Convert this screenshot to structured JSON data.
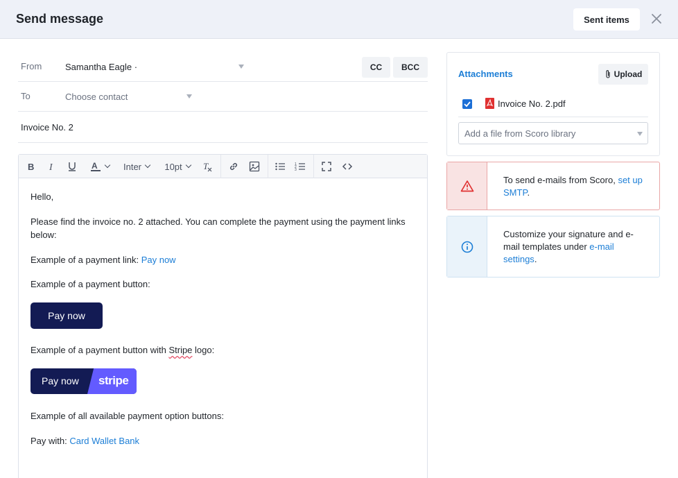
{
  "header": {
    "title": "Send message",
    "sent_items": "Sent items"
  },
  "form": {
    "from_label": "From",
    "from_value": "Samantha Eagle ·",
    "cc": "CC",
    "bcc": "BCC",
    "to_label": "To",
    "to_placeholder": "Choose contact",
    "subject": "Invoice No. 2"
  },
  "toolbar": {
    "font": "Inter",
    "size": "10pt",
    "icons": [
      "bold-icon",
      "italic-icon",
      "underline-icon",
      "text-color-icon",
      "clear-format-icon",
      "link-icon",
      "image-icon",
      "bullet-list-icon",
      "numbered-list-icon",
      "fullscreen-icon",
      "code-icon"
    ]
  },
  "body": {
    "greeting": "Hello,",
    "intro": "Please find the invoice no. 2 attached. You can complete the payment using the payment links below:",
    "link_prefix": "Example of a payment link: ",
    "link_text": "Pay now",
    "button_line": "Example of a payment button:",
    "button_label": "Pay now",
    "stripe_line_prefix": "Example of a payment button with ",
    "stripe_line_word": "Stripe",
    "stripe_line_suffix": " logo:",
    "stripe_pay": "Pay now",
    "stripe_logo": "stripe",
    "all_line": "Example of all available payment option buttons:",
    "pay_with": "Pay with: ",
    "options": "Card Wallet Bank"
  },
  "attachments": {
    "title": "Attachments",
    "upload": "Upload",
    "file": "Invoice No. 2.pdf",
    "file_checked": true,
    "library_placeholder": "Add a file from Scoro library"
  },
  "alerts": {
    "smtp_text": "To send e-mails from Scoro, ",
    "smtp_link": "set up SMTP",
    "smtp_end": ".",
    "info_text": "Customize your signature and e-mail templates under ",
    "info_link": "e-mail settings",
    "info_end": "."
  },
  "colors": {
    "accent": "#1c7ed6",
    "button_navy": "#131b54",
    "stripe_purple": "#635bff",
    "warn": "#e03131"
  }
}
